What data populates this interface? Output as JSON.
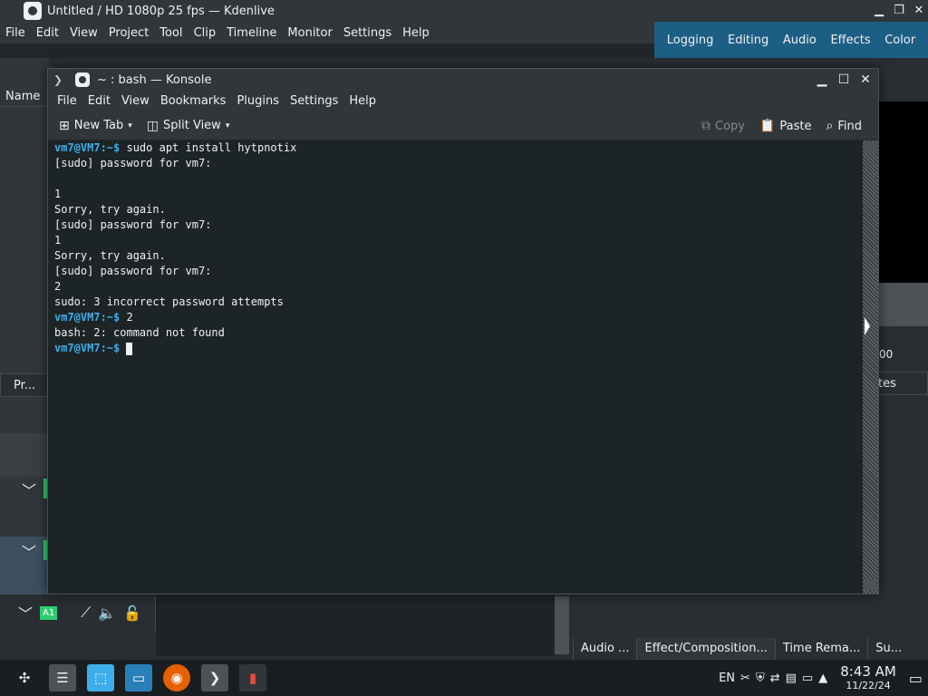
{
  "kdenlive": {
    "title": "Untitled / HD 1080p 25 fps — Kdenlive",
    "menu": [
      "File",
      "Edit",
      "View",
      "Project",
      "Tool",
      "Clip",
      "Timeline",
      "Monitor",
      "Settings",
      "Help"
    ],
    "workspaces": [
      "Logging",
      "Editing",
      "Audio",
      "Effects",
      "Color"
    ],
    "left_header": "Name",
    "project_tab": "Pr...",
    "timecode_fragment": "00",
    "right_tab_fragment": "tes",
    "track_label": "A1",
    "bottom_tabs": [
      "Audio ...",
      "Effect/Composition...",
      "Time Rema...",
      "Su..."
    ]
  },
  "konsole": {
    "title": "~ : bash — Konsole",
    "menu": [
      "File",
      "Edit",
      "View",
      "Bookmarks",
      "Plugins",
      "Settings",
      "Help"
    ],
    "toolbar": {
      "new_tab": "New Tab",
      "split_view": "Split View",
      "copy": "Copy",
      "paste": "Paste",
      "find": "Find"
    },
    "terminal_lines": [
      {
        "prompt": "vm7@VM7:~$",
        "text": " sudo apt install hytpnotix"
      },
      {
        "prompt": "",
        "text": "[sudo] password for vm7:"
      },
      {
        "prompt": "",
        "text": ""
      },
      {
        "prompt": "",
        "text": "1"
      },
      {
        "prompt": "",
        "text": "Sorry, try again."
      },
      {
        "prompt": "",
        "text": "[sudo] password for vm7:"
      },
      {
        "prompt": "",
        "text": "1"
      },
      {
        "prompt": "",
        "text": "Sorry, try again."
      },
      {
        "prompt": "",
        "text": "[sudo] password for vm7:"
      },
      {
        "prompt": "",
        "text": "2"
      },
      {
        "prompt": "",
        "text": "sudo: 3 incorrect password attempts"
      },
      {
        "prompt": "vm7@VM7:~$",
        "text": " 2"
      },
      {
        "prompt": "",
        "text": "bash: 2: command not found"
      },
      {
        "prompt": "vm7@VM7:~$",
        "text": " "
      }
    ]
  },
  "taskbar": {
    "keyboard_layout": "EN",
    "time": "8:43 AM",
    "date": "11/22/24"
  }
}
